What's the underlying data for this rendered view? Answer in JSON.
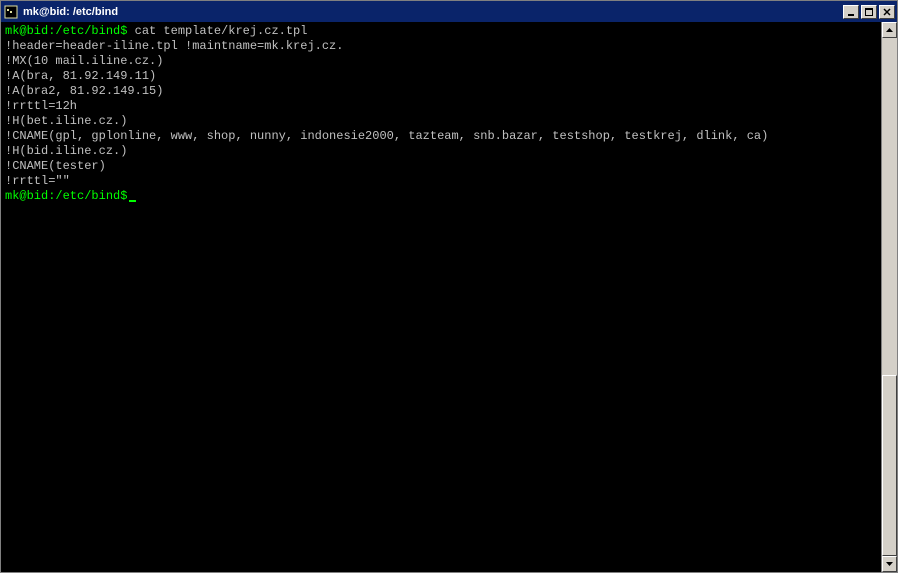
{
  "window": {
    "title": "mk@bid: /etc/bind"
  },
  "terminal": {
    "prompt1": "mk@bid:/etc/bind$",
    "command1": " cat template/krej.cz.tpl",
    "lines": [
      "!header=header-iline.tpl !maintname=mk.krej.cz.",
      "!MX(10 mail.iline.cz.)",
      "!A(bra, 81.92.149.11)",
      "!A(bra2, 81.92.149.15)",
      "!rrttl=12h",
      "!H(bet.iline.cz.)",
      "!CNAME(gpl, gplonline, www, shop, nunny, indonesie2000, tazteam, snb.bazar, testshop, testkrej, dlink, ca)",
      "!H(bid.iline.cz.)",
      "!CNAME(tester)",
      "!rrttl=\"\""
    ],
    "prompt2": "mk@bid:/etc/bind$"
  },
  "scrollbar": {
    "thumb_top_pct": 65,
    "thumb_height_pct": 35
  }
}
